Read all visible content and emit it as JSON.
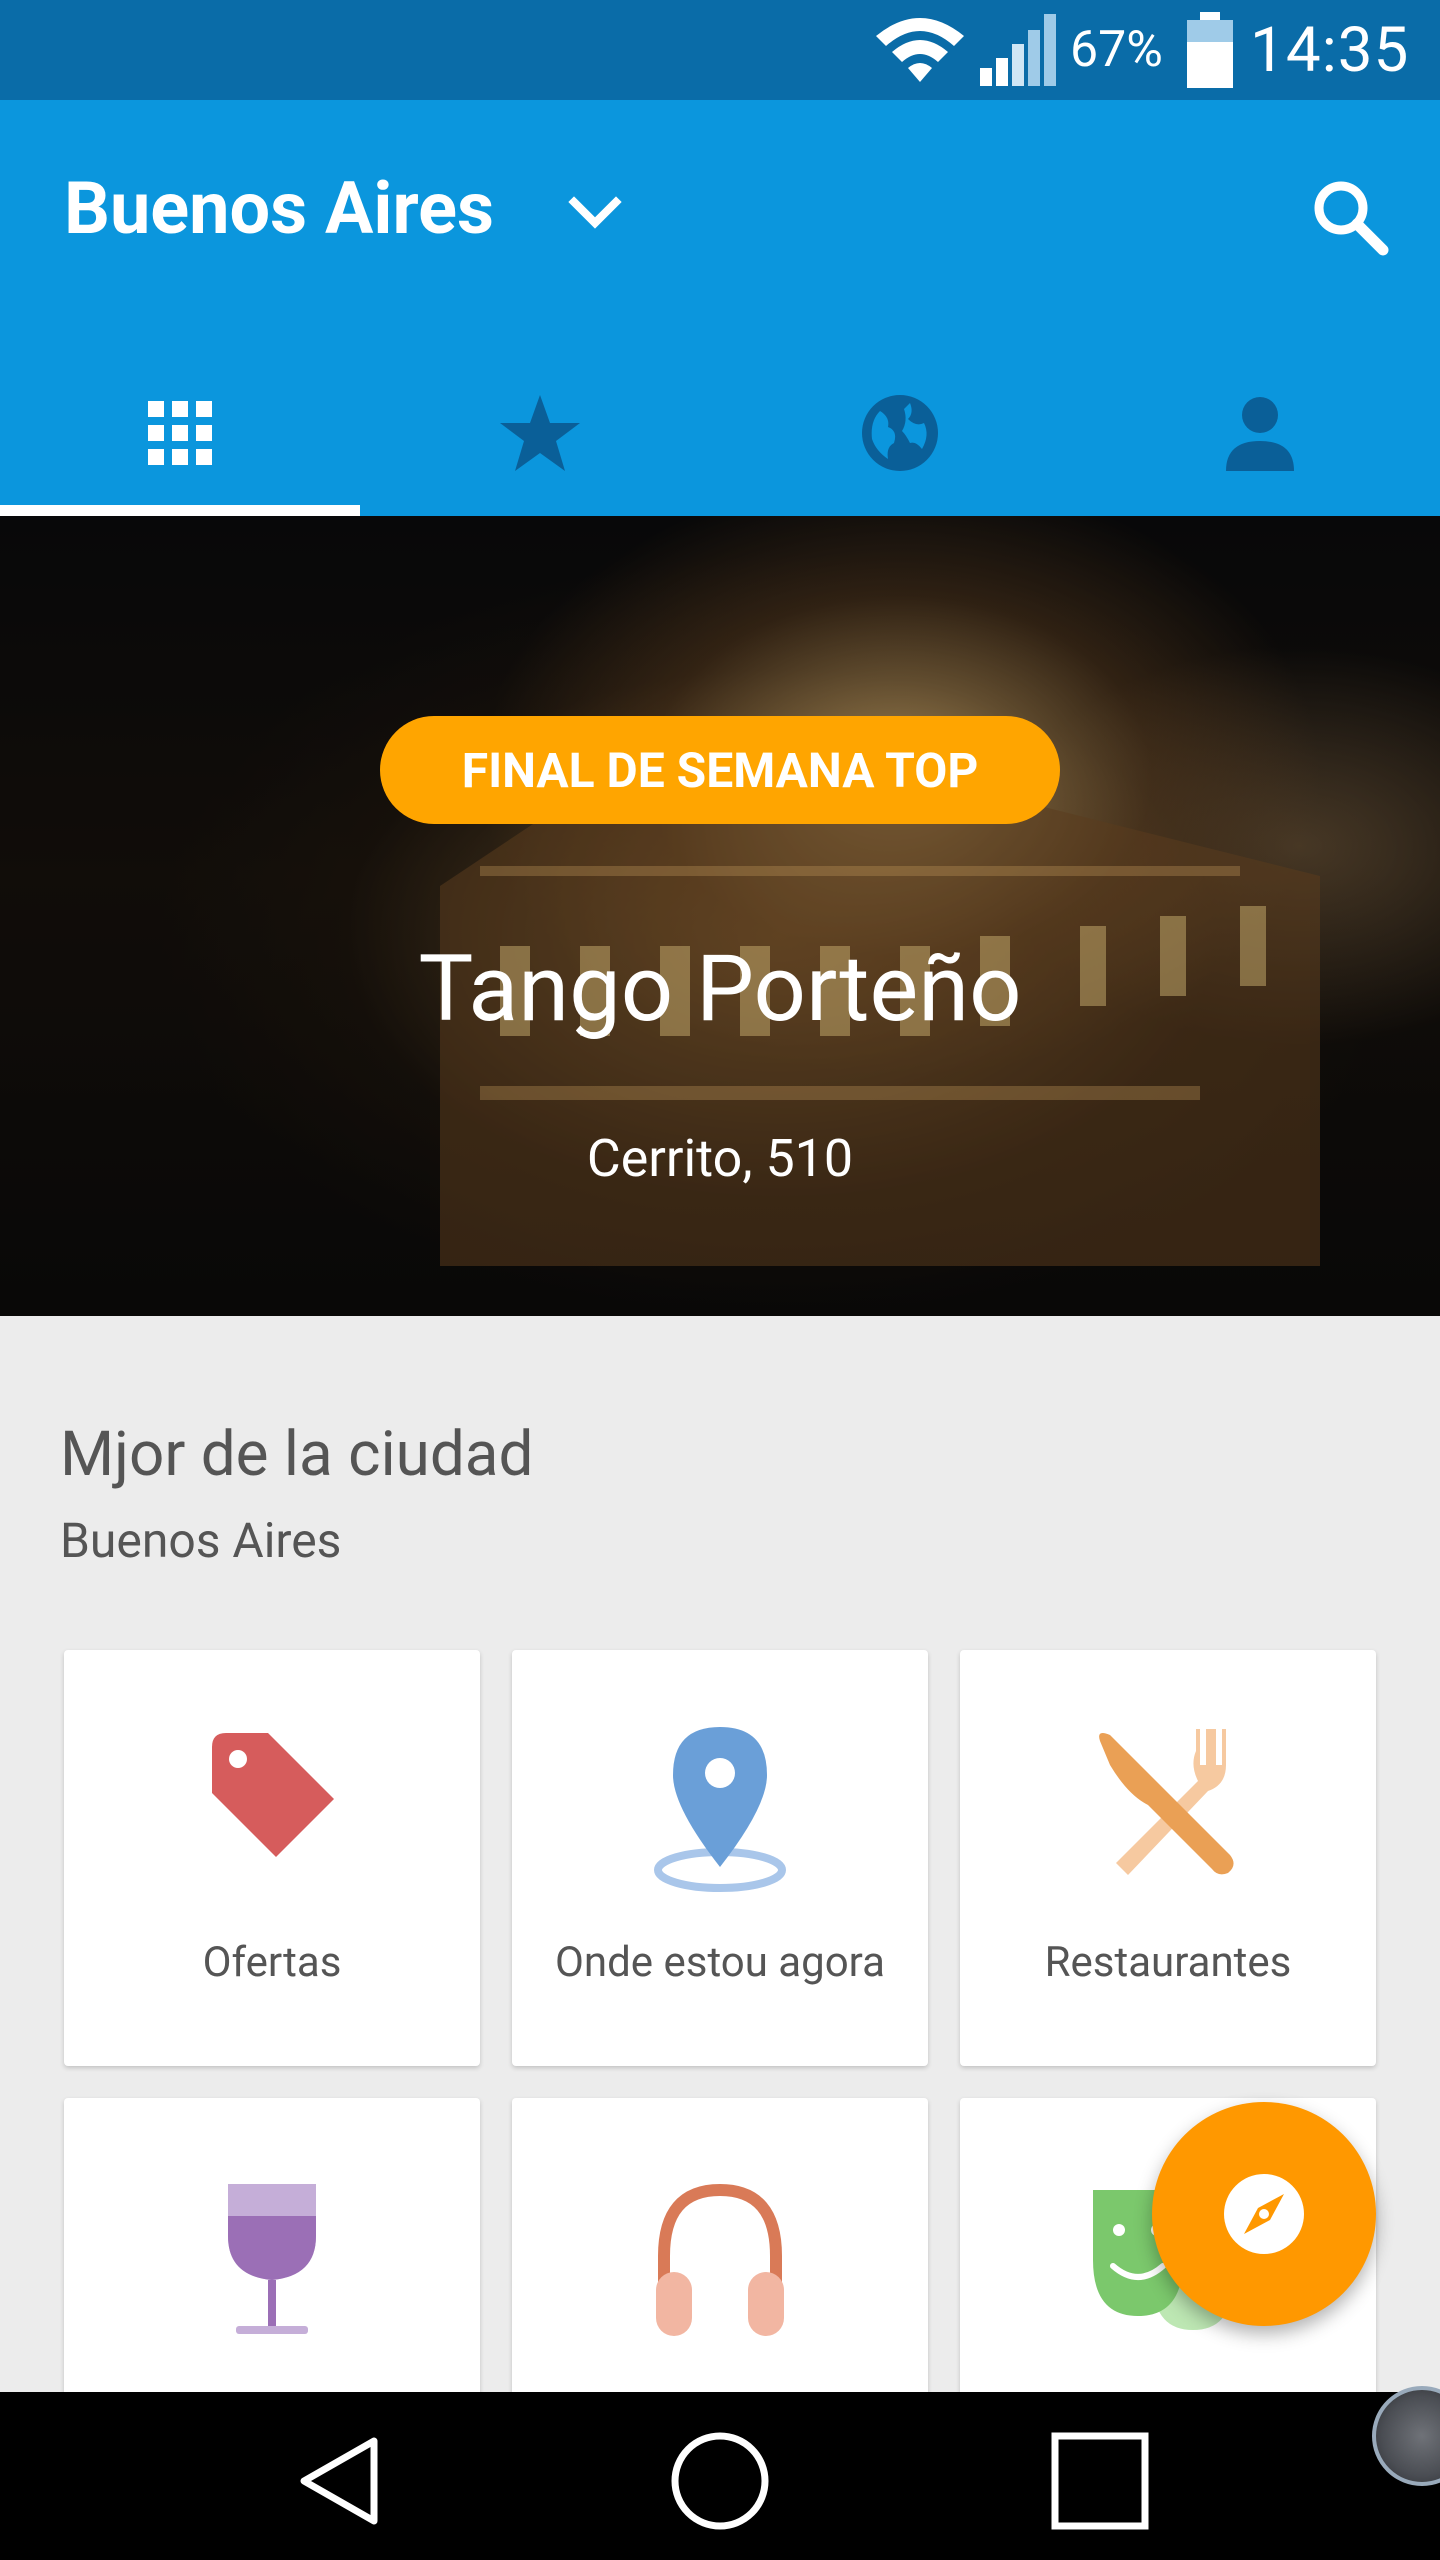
{
  "status_bar": {
    "battery_percent": "67%",
    "time": "14:35",
    "icons": [
      "wifi-icon",
      "signal-icon",
      "battery-icon"
    ]
  },
  "app_bar": {
    "city": "Buenos Aires",
    "dropdown_icon": "chevron-down-icon",
    "search_icon": "search-icon"
  },
  "tabs": [
    {
      "name": "grid-icon",
      "selected": true
    },
    {
      "name": "star-icon",
      "selected": false
    },
    {
      "name": "globe-icon",
      "selected": false
    },
    {
      "name": "person-icon",
      "selected": false
    }
  ],
  "hero": {
    "badge": "FINAL DE SEMANA TOP",
    "title": "Tango Porteño",
    "address": "Cerrito, 510"
  },
  "section": {
    "title": "Mjor de la ciudad",
    "subtitle": "Buenos Aires"
  },
  "categories": [
    {
      "label": "Ofertas",
      "icon": "tag-icon",
      "color": "#d65c5c"
    },
    {
      "label": "Onde estou agora",
      "icon": "location-pin-icon",
      "color": "#6a9fd8"
    },
    {
      "label": "Restaurantes",
      "icon": "knife-fork-icon",
      "color": "#eaa055"
    },
    {
      "label": "",
      "icon": "wine-glass-icon",
      "color": "#9b6fb6"
    },
    {
      "label": "",
      "icon": "headphones-icon",
      "color": "#d97a57"
    },
    {
      "label": "",
      "icon": "theater-masks-icon",
      "color": "#7bc86c"
    }
  ],
  "fab": {
    "icon": "compass-icon",
    "color": "#ff9800"
  },
  "nav_bar": {
    "buttons": [
      "back-icon",
      "home-icon",
      "recents-icon"
    ]
  },
  "colors": {
    "status_bar": "#0a6ca8",
    "app_bar": "#0b96dd",
    "badge": "#ffa500",
    "background": "#ececec"
  }
}
